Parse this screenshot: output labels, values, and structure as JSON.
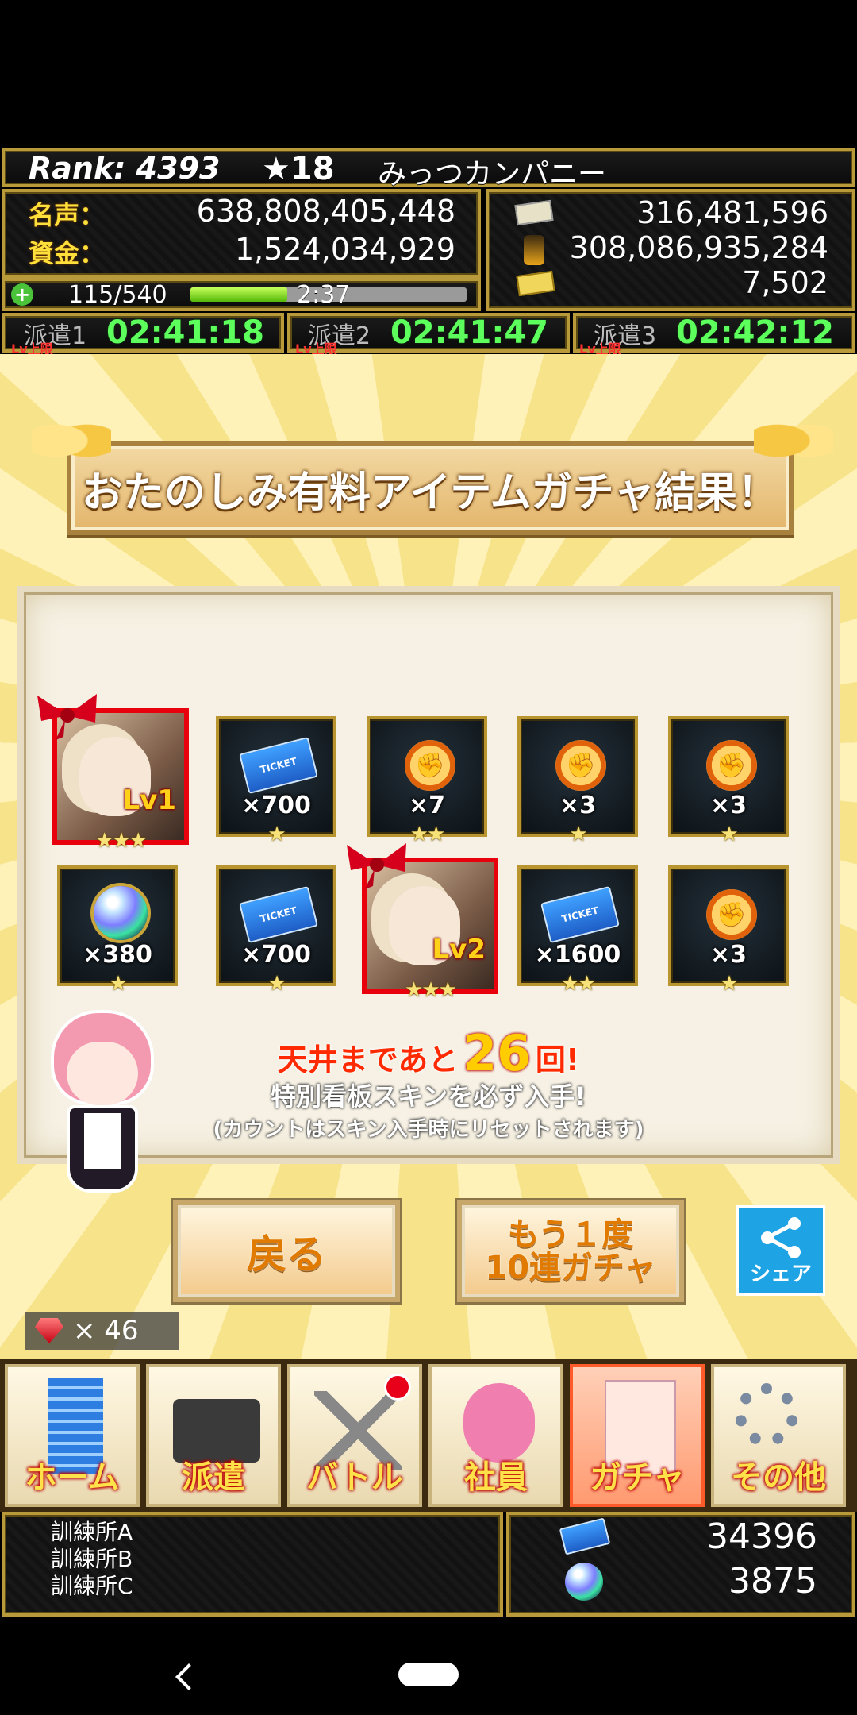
{
  "header": {
    "rank_label": "Rank: 4393",
    "stars": "★18",
    "company": "みっつカンパニー",
    "fame_label": "名声：",
    "fame_value": "638,808,405,448",
    "funds_label": "資金：",
    "funds_value": "1,524,034,929",
    "res1": "316,481,596",
    "res2": "308,086,935,284",
    "res3": "7,502",
    "stamina": "115/540",
    "stamina_level": 0.35,
    "timer": "2:37",
    "dispatch": [
      {
        "label": "派遣1",
        "tag": "Lv上限",
        "time": "02:41:18"
      },
      {
        "label": "派遣2",
        "tag": "Lv上限",
        "time": "02:41:47"
      },
      {
        "label": "派遣3",
        "tag": "Lv上限",
        "time": "02:42:12"
      }
    ]
  },
  "banner_title": "おたのしみ有料アイテムガチャ結果！",
  "results": {
    "row1": [
      {
        "kind": "portrait",
        "lv": "Lv1",
        "stars": "★★★"
      },
      {
        "kind": "ticket",
        "qty": "×700",
        "stars": "★"
      },
      {
        "kind": "fist",
        "qty": "×7",
        "stars": "★★"
      },
      {
        "kind": "fist",
        "qty": "×3",
        "stars": "★"
      },
      {
        "kind": "fist",
        "qty": "×3",
        "stars": "★"
      }
    ],
    "row2": [
      {
        "kind": "orb",
        "qty": "×380",
        "stars": "★"
      },
      {
        "kind": "ticket",
        "qty": "×700",
        "stars": "★"
      },
      {
        "kind": "portrait",
        "lv": "Lv2",
        "stars": "★★★"
      },
      {
        "kind": "ticket",
        "qty": "×1600",
        "stars": "★★"
      },
      {
        "kind": "fist",
        "qty": "×3",
        "stars": "★"
      }
    ]
  },
  "ceiling": {
    "prefix": "天井まであと",
    "count": "26",
    "suffix": "回!",
    "line2": "特別看板スキンを必ず入手!",
    "line3": "(カウントはスキン入手時にリセットされます)"
  },
  "buttons": {
    "back": "戻る",
    "again_1": "もう１度",
    "again_2": "10連ガチャ",
    "share": "シェア"
  },
  "gems": "× 46",
  "nav": [
    "ホーム",
    "派遣",
    "バトル",
    "社員",
    "ガチャ",
    "その他"
  ],
  "bottom": {
    "training": [
      "訓練所A",
      "訓練所B",
      "訓練所C"
    ],
    "tickets": "34396",
    "orbs": "3875"
  },
  "colors": {
    "accent_gold": "#b89a3a",
    "active_tab": "#ff5a2a",
    "share_blue": "#1ea4e4"
  }
}
